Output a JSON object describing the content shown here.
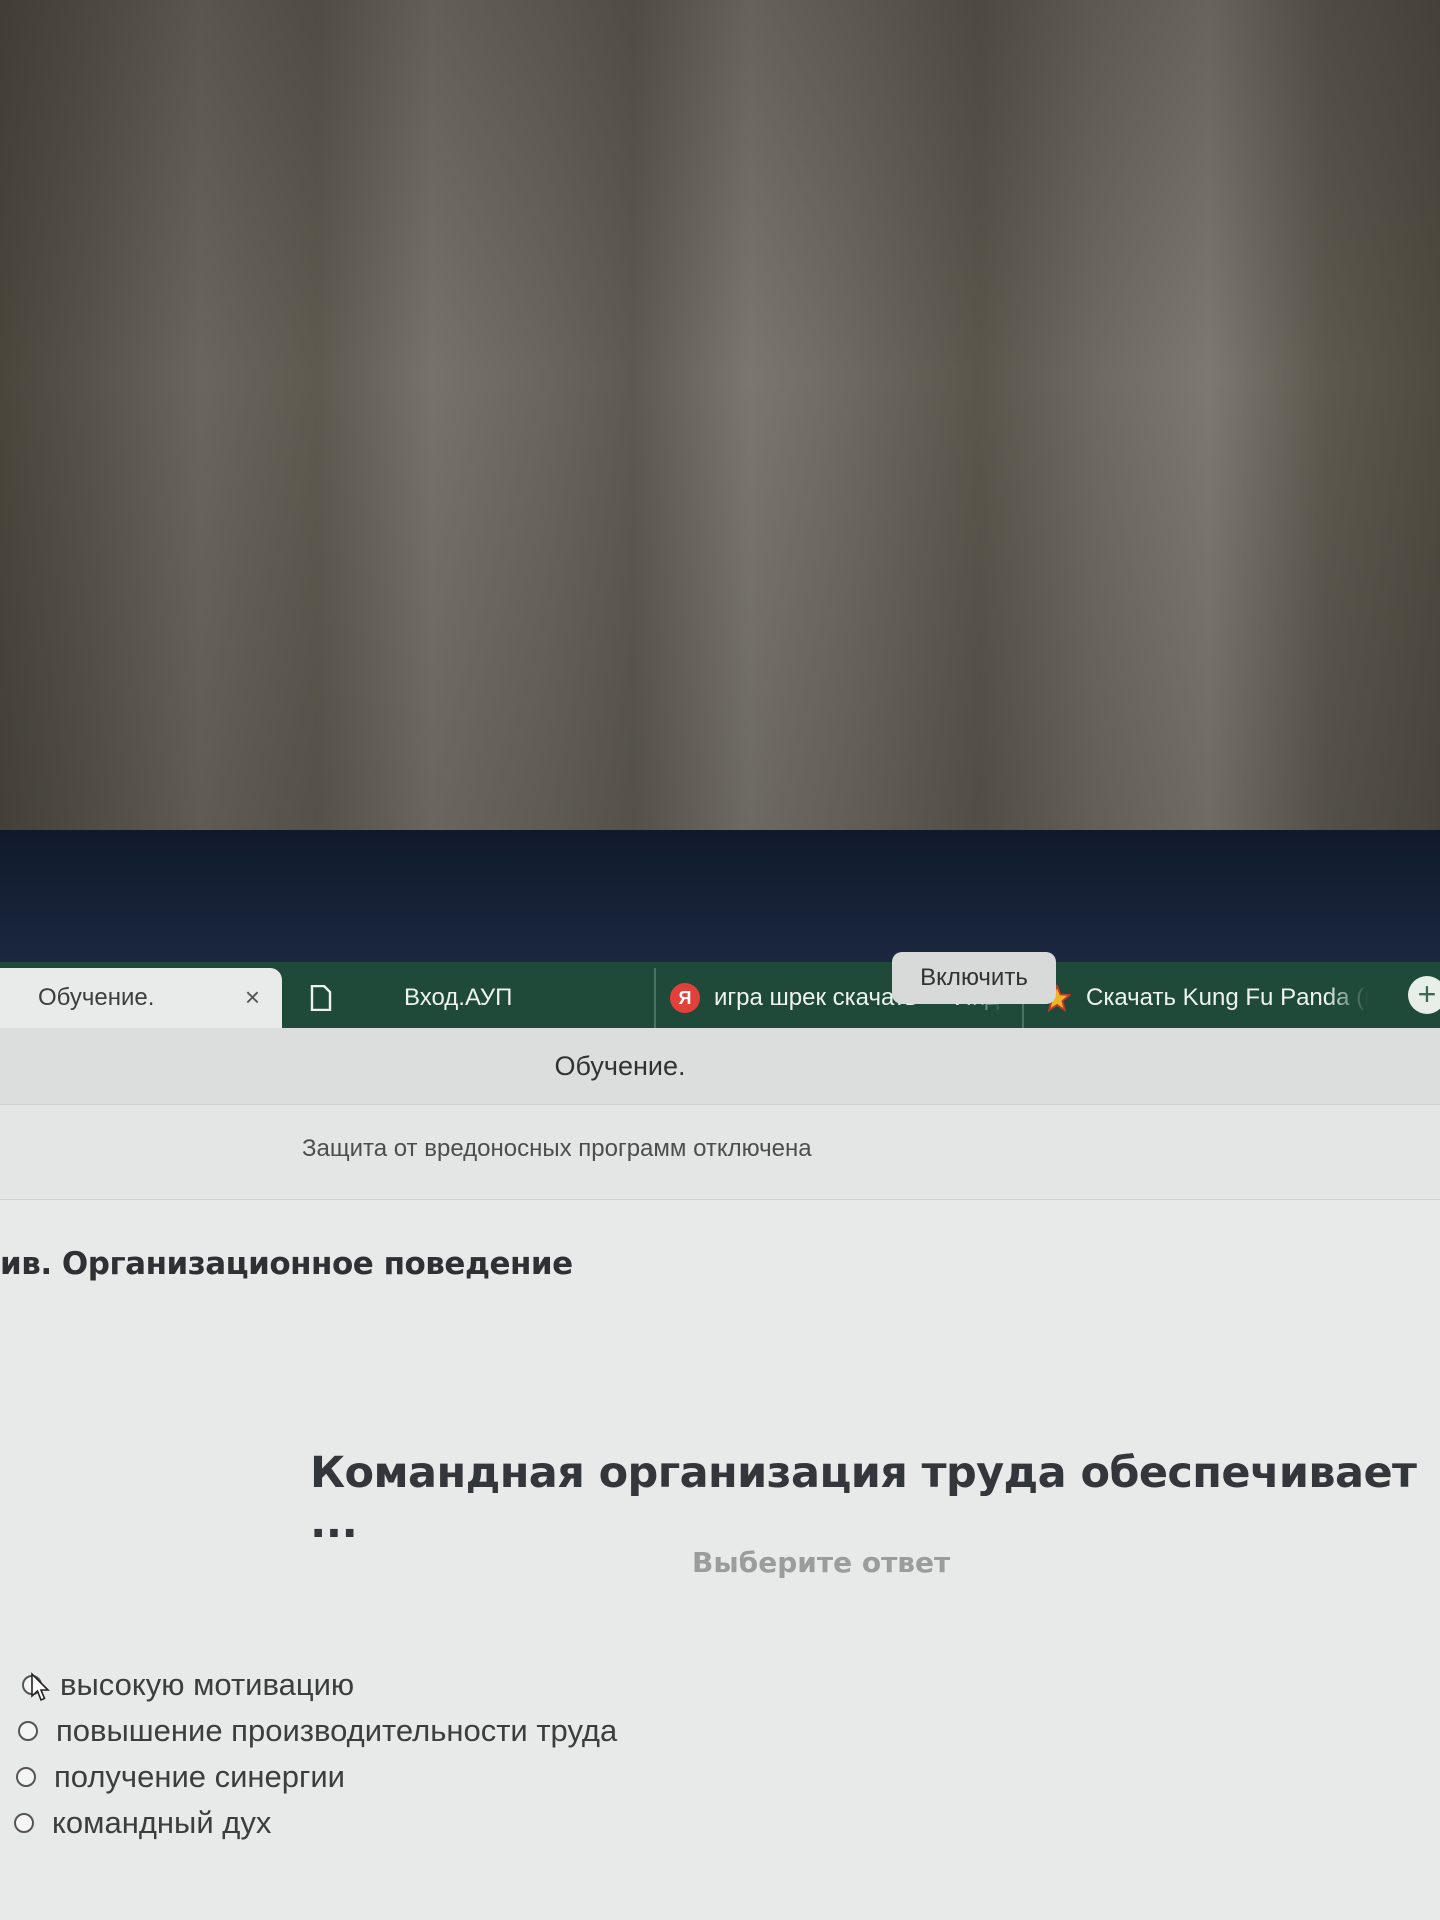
{
  "tabs": [
    {
      "label": "Обучение.",
      "active": true,
      "icon": "close-icon"
    },
    {
      "label": "Вход.АУП",
      "icon": "document-icon"
    },
    {
      "label": "игра шрек скачать — Янд",
      "icon": "yandex-icon",
      "icon_glyph": "Я"
    },
    {
      "label": "Скачать Kung Fu Panda (г",
      "icon": "star-icon"
    }
  ],
  "new_tab_glyph": "+",
  "close_glyph": "×",
  "page_title": "Обучение.",
  "protection": {
    "message": "Защита от вредоносных программ отключена",
    "button_label": "Включить"
  },
  "course_title": "ив. Организационное поведение",
  "question": {
    "text": "Командная организация труда обеспечивает ...",
    "hint": "Выберите ответ",
    "options": [
      {
        "label": "высокую мотивацию"
      },
      {
        "label": "повышение производительности труда"
      },
      {
        "label": "получение синергии"
      },
      {
        "label": "командный дух"
      }
    ]
  },
  "colors": {
    "tabbar": "#1f4a3a",
    "page_bg": "#e8eae9",
    "question_text": "#33363a",
    "hint_text": "#9a9d9c"
  }
}
